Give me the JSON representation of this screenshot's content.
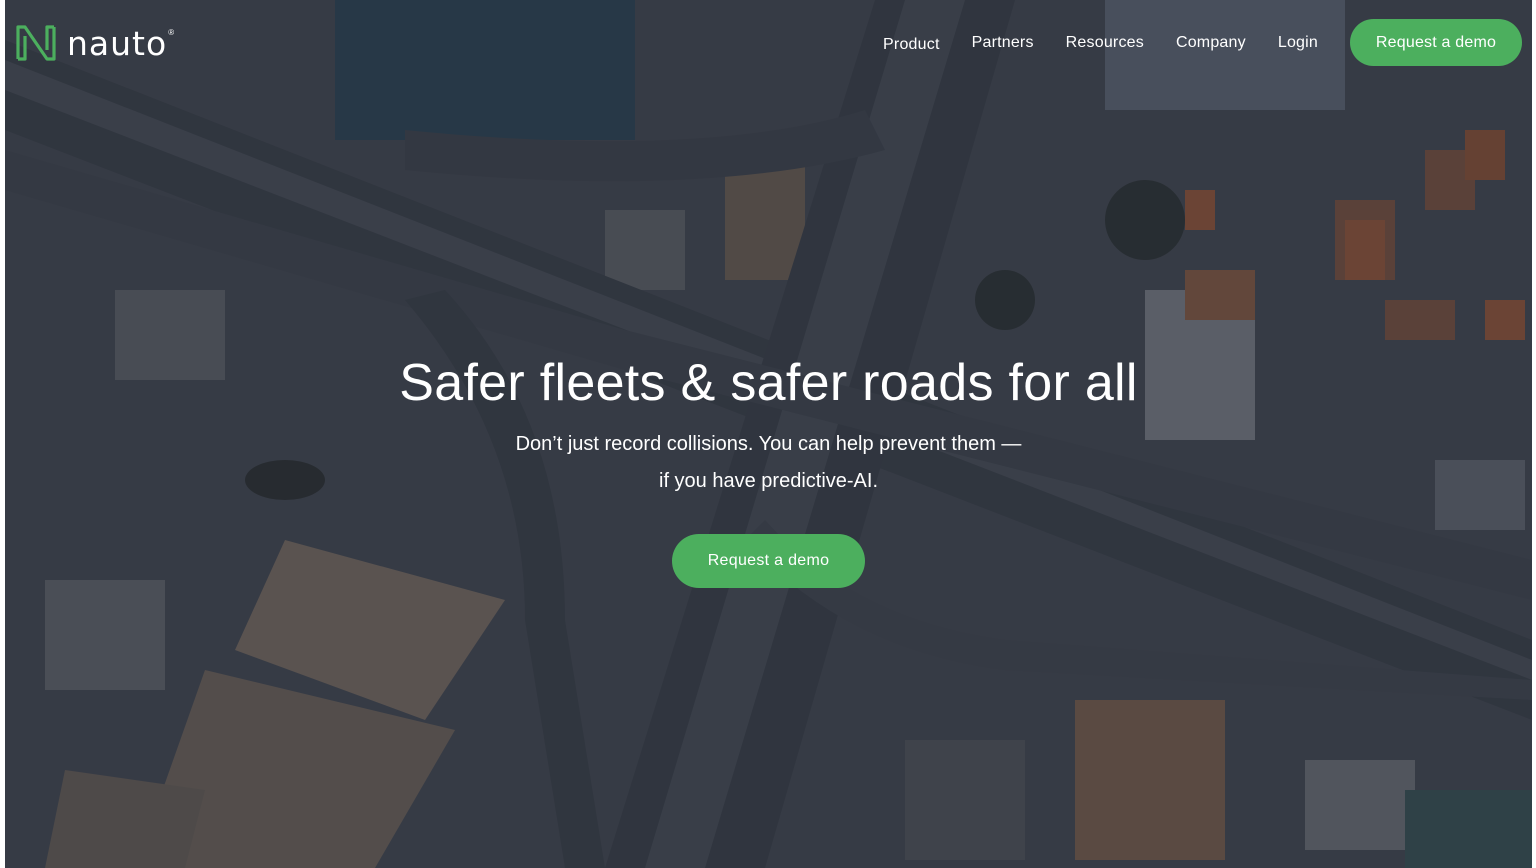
{
  "brand": {
    "name": "nauto",
    "registered_mark": "®",
    "accent_color": "#4caf5e"
  },
  "nav": {
    "items": [
      {
        "label": "Product"
      },
      {
        "label": "Partners"
      },
      {
        "label": "Resources"
      },
      {
        "label": "Company"
      },
      {
        "label": "Login"
      }
    ],
    "cta_label": "Request a demo"
  },
  "hero": {
    "headline": "Safer fleets & safer roads for all",
    "subline_1": "Don’t just record collisions. You can help prevent them —",
    "subline_2": "if you have predictive-AI.",
    "cta_label": "Request a demo",
    "background": "aerial-highway-interchange-image"
  }
}
